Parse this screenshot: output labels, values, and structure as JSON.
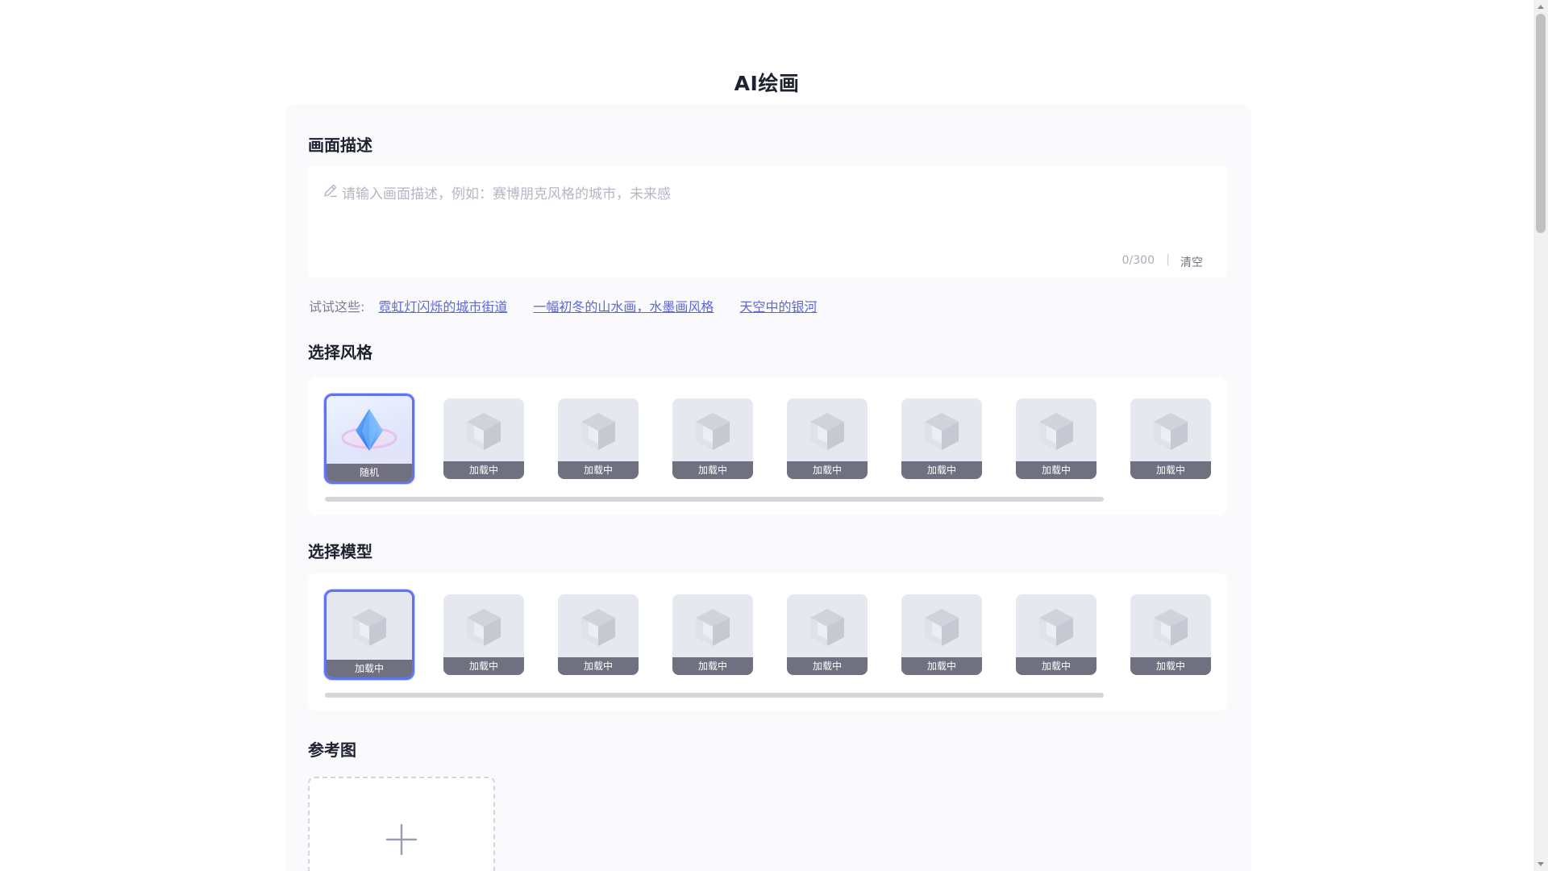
{
  "page": {
    "title": "AI绘画"
  },
  "prompt": {
    "section_title": "画面描述",
    "placeholder": "请输入画面描述，例如：赛博朋克风格的城市，未来感",
    "counter": "0/300",
    "separator": "|",
    "clear_label": "清空"
  },
  "suggestions": {
    "label": "试试这些:",
    "items": [
      {
        "label": "霓虹灯闪烁的城市街道"
      },
      {
        "label": "一幅初冬的山水画，水墨画风格"
      },
      {
        "label": "天空中的银河"
      }
    ]
  },
  "styles": {
    "section_title": "选择风格",
    "items": [
      {
        "label": "随机",
        "selected": true
      },
      {
        "label": "加载中"
      },
      {
        "label": "加载中"
      },
      {
        "label": "加载中"
      },
      {
        "label": "加载中"
      },
      {
        "label": "加载中"
      },
      {
        "label": "加载中"
      },
      {
        "label": "加载中"
      }
    ]
  },
  "models": {
    "section_title": "选择模型",
    "items": [
      {
        "label": "加载中",
        "selected": true
      },
      {
        "label": "加载中"
      },
      {
        "label": "加载中"
      },
      {
        "label": "加载中"
      },
      {
        "label": "加载中"
      },
      {
        "label": "加载中"
      },
      {
        "label": "加载中"
      },
      {
        "label": "加载中"
      }
    ]
  },
  "reference": {
    "section_title": "参考图",
    "upload_icon": "plus-icon"
  },
  "theme": {
    "accent": "#6172f3",
    "link": "#5a67d8",
    "panel_bg": "#fafafd",
    "caption_bg": "#6f7180"
  }
}
